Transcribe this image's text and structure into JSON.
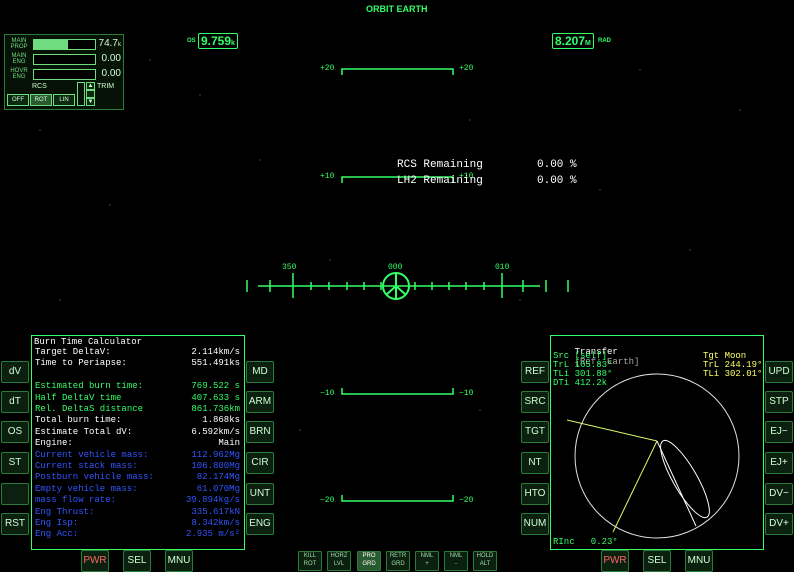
{
  "hud": {
    "mode_title": "ORBIT EARTH",
    "os_label": "OS",
    "os_value": "9.759",
    "os_unit": "k",
    "rad_value": "8.207",
    "rad_unit": "M",
    "rad_label": "RAD",
    "pitch_labels": [
      "+20",
      "+20",
      "+10",
      "+10",
      "−10",
      "−10",
      "−20",
      "−20"
    ],
    "heading_labels": [
      "350",
      "000",
      "010"
    ],
    "rcs_remaining_label": "RCS Remaining",
    "rcs_remaining_value": "0.00 %",
    "lh2_remaining_label": "LH2 Remaining",
    "lh2_remaining_value": "0.00 %"
  },
  "engines": {
    "rows": [
      {
        "name": "MAIN PROP",
        "value": "74.7",
        "unit": "k",
        "fill": 0.55
      },
      {
        "name": "MAIN ENG",
        "value": "0.00",
        "unit": "",
        "fill": 0
      },
      {
        "name": "HOVR ENG",
        "value": "0.00",
        "unit": "",
        "fill": 0
      }
    ],
    "rcs_label": "RCS",
    "rcs_buttons": [
      "OFF",
      "ROT",
      "LIN"
    ],
    "rcs_active": "ROT",
    "trim_label": "TRIM"
  },
  "left_mfd": {
    "title": "Burn Time Calculator",
    "lines": [
      {
        "label": "Target DeltaV:",
        "value": "2.114km/s",
        "color": "white"
      },
      {
        "label": "Time to Periapse:",
        "value": "551.491ks",
        "color": "white"
      },
      {
        "label": "",
        "value": "",
        "color": "white"
      },
      {
        "label": "Estimated burn time:",
        "value": "769.522 s",
        "color": "green"
      },
      {
        "label": "Half DeltaV time",
        "value": "407.633 s",
        "color": "green"
      },
      {
        "label": "Rel. DeltaS distance",
        "value": "861.736km",
        "color": "green"
      },
      {
        "label": "Total burn time:",
        "value": "1.868ks",
        "color": "white"
      },
      {
        "label": "Estimate Total dV:",
        "value": "6.592km/s",
        "color": "white"
      },
      {
        "label": "Engine:",
        "value": "Main",
        "color": "white"
      },
      {
        "label": "Current vehicle mass:",
        "value": "112.962Mg",
        "color": "blue"
      },
      {
        "label": "Current stack mass:",
        "value": "106.800Mg",
        "color": "blue"
      },
      {
        "label": "Postburn vehicle mass:",
        "value": "82.174Mg",
        "color": "blue"
      },
      {
        "label": "Empty vehicle mass:",
        "value": "61.070Mg",
        "color": "blue"
      },
      {
        "label": "mass flow rate:",
        "value": "39.894kg/s",
        "color": "blue"
      },
      {
        "label": "Eng Thrust:",
        "value": "335.617kN",
        "color": "blue"
      },
      {
        "label": "Eng Isp:",
        "value": "8.342km/s",
        "color": "blue"
      },
      {
        "label": "Eng Acc:",
        "value": "2.935 m/s²",
        "color": "blue"
      }
    ],
    "left_buttons": [
      "dV",
      "dT",
      "OS",
      "ST",
      "",
      "RST"
    ],
    "right_buttons": [
      "MD",
      "ARM",
      "BRN",
      "CIR",
      "UNT",
      "ENG"
    ],
    "bottom_buttons": [
      "PWR",
      "SEL",
      "MNU"
    ]
  },
  "right_mfd": {
    "title": "Transfer",
    "ref": "[Ref: Earth]",
    "src_lines": [
      "Src [self]",
      "TrL 165.83°",
      "TLi 301.88°",
      "DTi 412.2k"
    ],
    "tgt_lines": [
      "Tgt Moon",
      "TrL 244.19°",
      "TLi 302.01°"
    ],
    "rinc": "RInc   0.23°",
    "left_buttons": [
      "REF",
      "SRC",
      "TGT",
      "NT",
      "HTO",
      "NUM"
    ],
    "right_buttons": [
      "UPD",
      "STP",
      "EJ−",
      "EJ+",
      "DV−",
      "DV+"
    ],
    "bottom_buttons": [
      "PWR",
      "SEL",
      "MNU"
    ]
  },
  "autopilot": {
    "buttons": [
      {
        "l1": "KILL",
        "l2": "ROT"
      },
      {
        "l1": "HORZ",
        "l2": "LVL"
      },
      {
        "l1": "PRO",
        "l2": "GRD"
      },
      {
        "l1": "RETR",
        "l2": "GRD"
      },
      {
        "l1": "NML",
        "l2": "+"
      },
      {
        "l1": "NML",
        "l2": "-"
      },
      {
        "l1": "HOLD",
        "l2": "ALT"
      }
    ],
    "active": "PRO"
  },
  "colors": {
    "hud_green": "#33ff66",
    "blue_text": "#3355ff",
    "white_text": "#ffffff",
    "red_label": "#ff6666",
    "tgt_yellow": "#ffff66"
  }
}
